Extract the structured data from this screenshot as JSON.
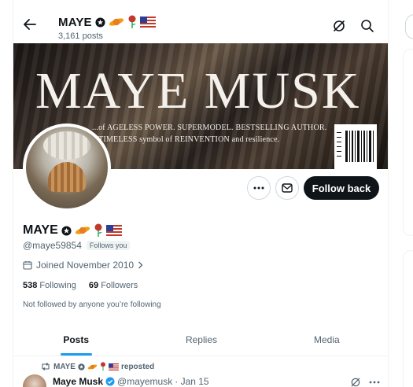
{
  "header": {
    "name": "MAYE",
    "post_count": "3,161 posts"
  },
  "banner": {
    "title": "MAYE MUSK",
    "line1": "...of AGELESS POWER. SUPERMODEL. BESTSELLING AUTHOR.",
    "line2": "...TIMELESS symbol of REINVENTION and resilience."
  },
  "actions": {
    "follow_back": "Follow back"
  },
  "profile": {
    "name": "MAYE",
    "handle": "@maye59854",
    "follows_you": "Follows you",
    "joined": "Joined November 2010",
    "following_count": "538",
    "following_label": "Following",
    "followers_count": "69",
    "followers_label": "Followers",
    "not_followed": "Not followed by anyone you’re following"
  },
  "tabs": [
    {
      "label": "Posts",
      "active": true
    },
    {
      "label": "Replies",
      "active": false
    },
    {
      "label": "Media",
      "active": false
    }
  ],
  "tweet": {
    "reposter": "MAYE",
    "repost_label": "reposted",
    "author": "Maye Musk",
    "handle": "@mayemusk",
    "date": "· Jan 15"
  },
  "colors": {
    "accent": "#1d9bf0",
    "text": "#0f1419",
    "secondary": "#536471"
  },
  "icons": [
    "back-arrow-icon",
    "grok-icon",
    "search-icon",
    "more-icon",
    "message-icon",
    "calendar-icon",
    "chevron-right-icon",
    "repost-icon",
    "verified-icon",
    "saturn-emoji",
    "rose-emoji",
    "us-flag-emoji",
    "star-badge-icon"
  ]
}
